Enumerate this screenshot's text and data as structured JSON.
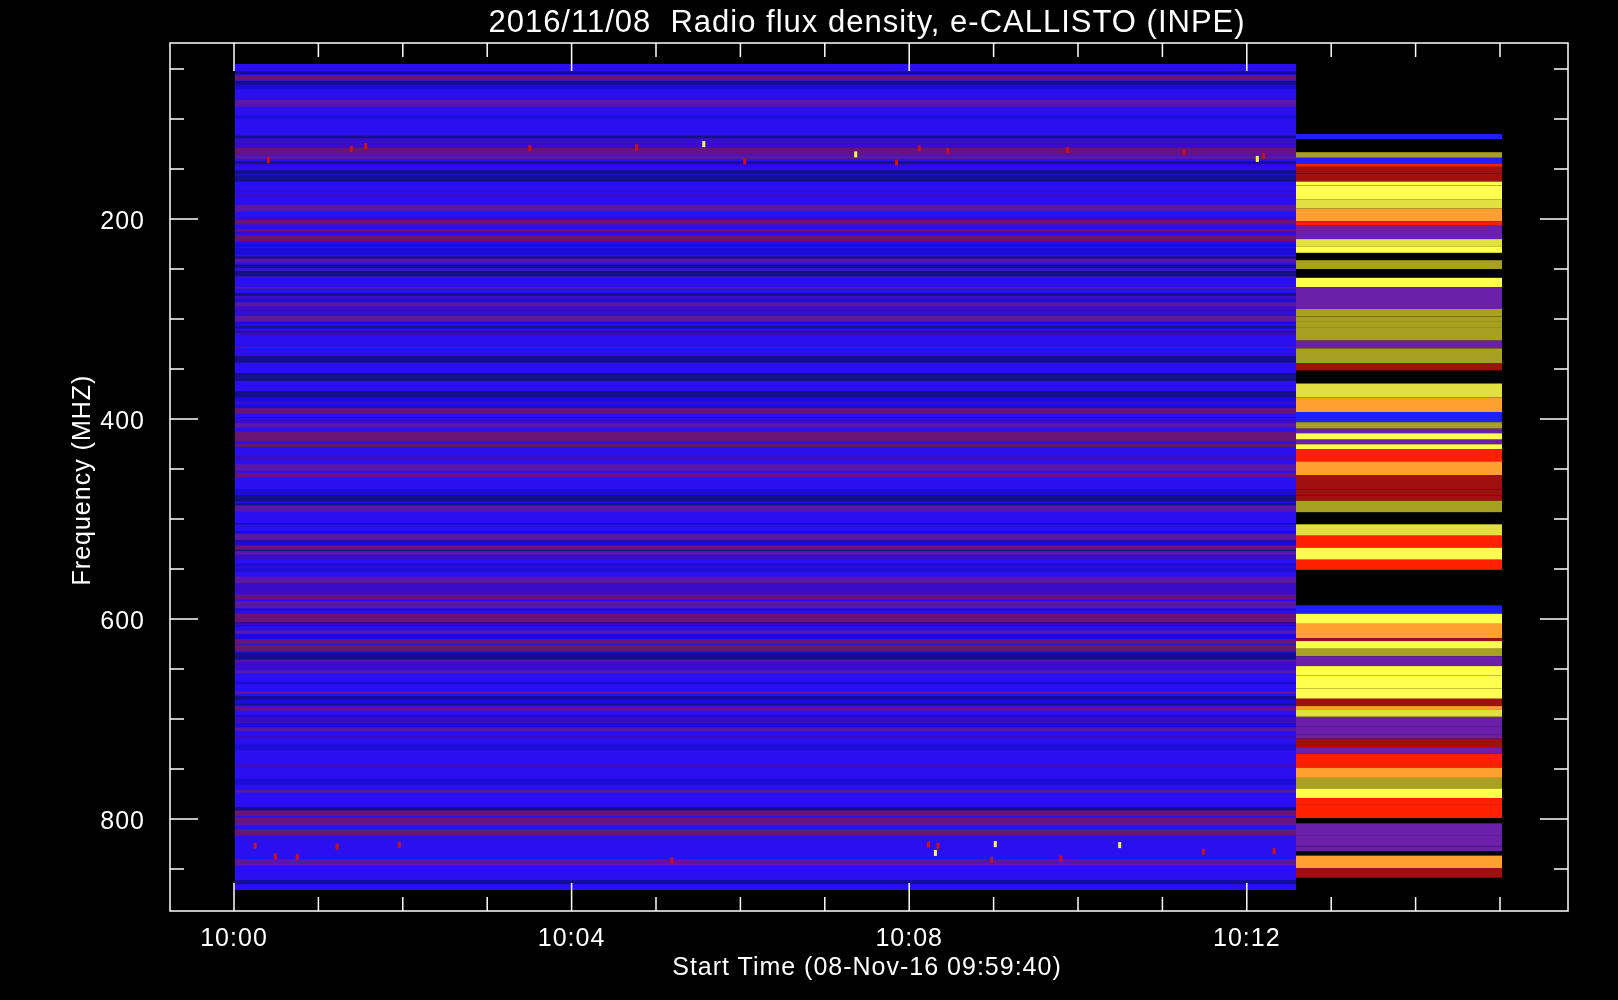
{
  "plot": {
    "title": "2016/11/08  Radio flux density, e-CALLISTO (INPE)",
    "y_axis": {
      "label": "Frequency (MHZ)",
      "ticks": [
        "200",
        "400",
        "600",
        "800"
      ]
    },
    "x_axis": {
      "label": "Start Time (08-Nov-16 09:59:40)",
      "ticks": [
        "10:00",
        "10:04",
        "10:08",
        "10:12"
      ]
    }
  }
}
